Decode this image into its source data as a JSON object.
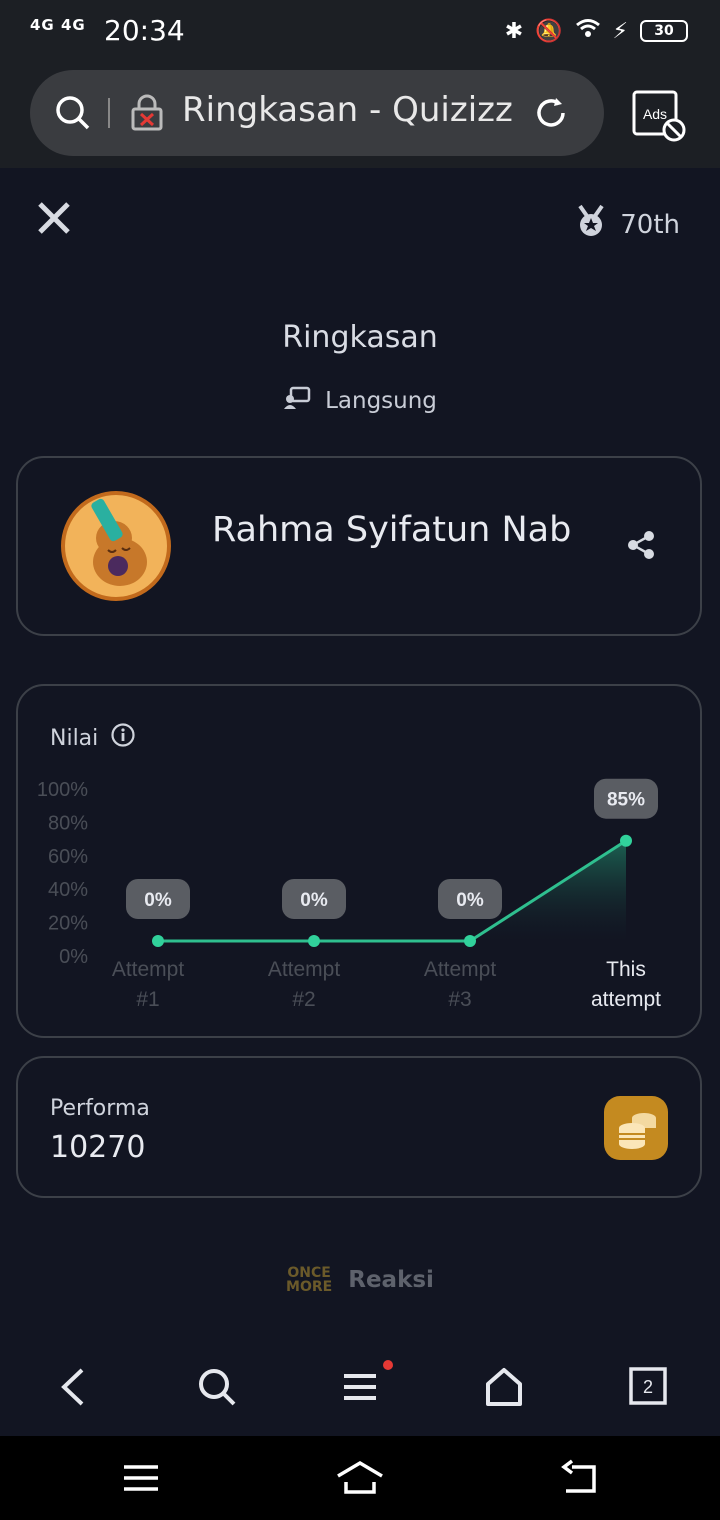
{
  "status": {
    "network": "4G 4G",
    "time": "20:34",
    "battery": "30"
  },
  "browser": {
    "url_text": "Ringkasan - Quizizz",
    "ads_label": "Ads"
  },
  "header": {
    "rank": "70th"
  },
  "summary": {
    "title": "Ringkasan",
    "mode": "Langsung"
  },
  "player": {
    "name": "Rahma Syifatun Nab"
  },
  "score": {
    "label": "Nilai"
  },
  "chart_data": {
    "type": "line",
    "categories": [
      "Attempt #1",
      "Attempt #2",
      "Attempt #3",
      "This attempt"
    ],
    "values": [
      0,
      0,
      0,
      85
    ],
    "data_labels": [
      "0%",
      "0%",
      "0%",
      "85%"
    ],
    "y_ticks": [
      "100%",
      "80%",
      "60%",
      "40%",
      "20%",
      "0%"
    ],
    "ylim": [
      0,
      100
    ],
    "grid": false,
    "colors": {
      "line": "#2fbf8f",
      "point": "#31d19b",
      "label_bg": "#5a5d63"
    }
  },
  "performance": {
    "label": "Performa",
    "value": "10270"
  },
  "reaction": {
    "logo_line1": "ONCE",
    "logo_line2": "MORE",
    "label": "Reaksi"
  },
  "navbar": {
    "tabs_count": "2"
  },
  "colors": {
    "background": "#121522",
    "accent_green": "#2fbf8f",
    "coin": "#c48a20"
  }
}
